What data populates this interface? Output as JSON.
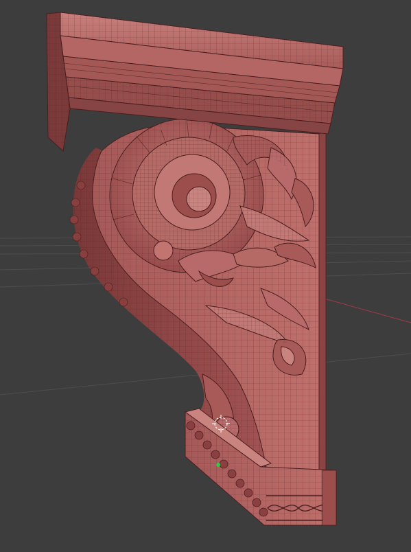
{
  "viewport": {
    "background": "#3d3d3d",
    "grid_color": "#4e4e4e",
    "x_axis_color": "#a33a4a"
  },
  "model": {
    "name": "carved-corbel-bracket",
    "shading": "solid-with-wireframe",
    "base_color": "#b46464",
    "shadow_color": "#6e3232",
    "highlight_color": "#d08a86",
    "wire_color": "#4a1e1e"
  },
  "markers": {
    "selected_vertex_color": "#2ecc40",
    "pivot_icon": "3d-cursor-icon"
  }
}
